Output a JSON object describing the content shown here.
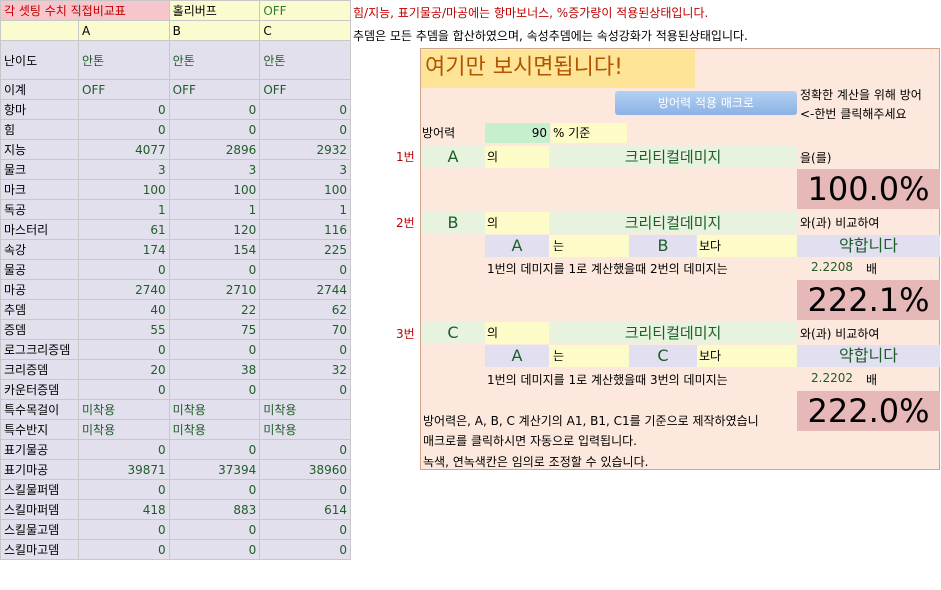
{
  "header": {
    "title": "각 셋팅 수치 직접비교표",
    "subtitle": "홀리버프",
    "off": "OFF",
    "col_a": "A",
    "col_b": "B",
    "col_c": "C"
  },
  "difficulty": {
    "label": "난이도",
    "values": [
      "안톤",
      "안톤",
      "안톤"
    ]
  },
  "ige": {
    "label": "이계",
    "values": [
      "OFF",
      "OFF",
      "OFF"
    ]
  },
  "rows": [
    {
      "label": "항마",
      "values": [
        "0",
        "0",
        "0"
      ]
    },
    {
      "label": "힘",
      "values": [
        "0",
        "0",
        "0"
      ]
    },
    {
      "label": "지능",
      "values": [
        "4077",
        "2896",
        "2932"
      ]
    },
    {
      "label": "물크",
      "values": [
        "3",
        "3",
        "3"
      ]
    },
    {
      "label": "마크",
      "values": [
        "100",
        "100",
        "100"
      ]
    },
    {
      "label": "독공",
      "values": [
        "1",
        "1",
        "1"
      ]
    },
    {
      "label": "마스터리",
      "values": [
        "61",
        "120",
        "116"
      ]
    },
    {
      "label": "속강",
      "values": [
        "174",
        "154",
        "225"
      ]
    },
    {
      "label": "물공",
      "values": [
        "0",
        "0",
        "0"
      ]
    },
    {
      "label": "마공",
      "values": [
        "2740",
        "2710",
        "2744"
      ]
    },
    {
      "label": "추뎀",
      "values": [
        "40",
        "22",
        "62"
      ]
    },
    {
      "label": "증뎀",
      "values": [
        "55",
        "75",
        "70"
      ]
    },
    {
      "label": "로그크리증뎀",
      "values": [
        "0",
        "0",
        "0"
      ]
    },
    {
      "label": "크리증뎀",
      "values": [
        "20",
        "38",
        "32"
      ]
    },
    {
      "label": "카운터증뎀",
      "values": [
        "0",
        "0",
        "0"
      ]
    },
    {
      "label": "특수목걸이",
      "values": [
        "미착용",
        "미착용",
        "미착용"
      ],
      "text": true
    },
    {
      "label": "특수반지",
      "values": [
        "미착용",
        "미착용",
        "미착용"
      ],
      "text": true
    },
    {
      "label": "표기물공",
      "values": [
        "0",
        "0",
        "0"
      ]
    },
    {
      "label": "표기마공",
      "values": [
        "39871",
        "37394",
        "38960"
      ]
    },
    {
      "label": "스킬물퍼뎀",
      "values": [
        "0",
        "0",
        "0"
      ]
    },
    {
      "label": "스킬마퍼뎀",
      "values": [
        "418",
        "883",
        "614"
      ]
    },
    {
      "label": "스킬물고뎀",
      "values": [
        "0",
        "0",
        "0"
      ]
    },
    {
      "label": "스킬마고뎀",
      "values": [
        "0",
        "0",
        "0"
      ]
    }
  ],
  "notes": {
    "line1": "힘/지능, 표기물공/마공에는 항마보너스, %증가량이 적용된상태입니다.",
    "line2": "추뎀은 모든 추뎀을 합산하였으며, 속성추뎀에는 속성강화가 적용된상태입니다."
  },
  "panel": {
    "heading": "여기만 보시면됩니다!",
    "macro_button": "방어력 적용 매크로",
    "macro_note1": "정확한 계산을 위해 방어",
    "macro_note2": "<-한번 클릭해주세요",
    "def_label": "방어력",
    "def_value": "90",
    "def_suffix": "% 기준",
    "particle_of": "의",
    "stat_name": "크리티컬데미지",
    "result_word": "을(를)",
    "compare_word": "와(과) 비교하여",
    "neun": "는",
    "boda": "보다",
    "weak": "약합니다",
    "calc2": "1번의 데미지를 1로 계산했을때 2번의 데미지는",
    "calc3": "1번의 데미지를 1로 계산했을때 3번의 데미지는",
    "bae": "배",
    "n1": "1번",
    "n2": "2번",
    "n3": "3번",
    "k1": "A",
    "k2": "B",
    "k3": "C",
    "pct1": "100.0%",
    "ratio2": "2.2208",
    "pct2": "222.1%",
    "ratio3": "2.2202",
    "pct3": "222.0%",
    "foot1": "방어력은, A, B, C 계산기의 A1, B1, C1를 기준으로 제작하였습니",
    "foot2": "매크로를 클릭하시면 자동으로 입력됩니다.",
    "foot3": "녹색, 연녹색칸은 임의로 조정할 수 있습니다."
  }
}
